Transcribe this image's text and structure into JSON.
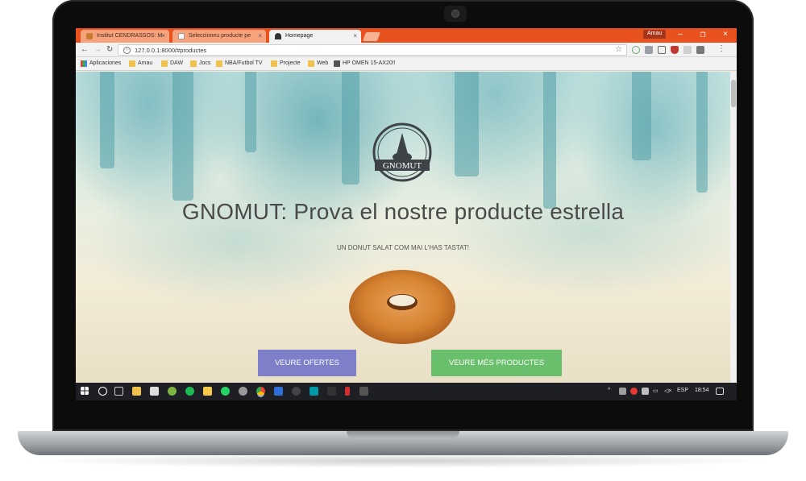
{
  "browser": {
    "tabs": [
      {
        "title": "Institut CENDRASSOS: M"
      },
      {
        "title": "Seleccioneu producte pe"
      },
      {
        "title": "Homepage"
      }
    ],
    "profile_name": "Amau",
    "url": "127.0.0.1:8000/#productes",
    "bookmarks": [
      "Aplicaciones",
      "Amau",
      "DAW",
      "Jocs",
      "NBA/Futbol TV",
      "Projecte",
      "Web",
      "HP OMEN 15-AX20!!"
    ]
  },
  "page": {
    "logo_text": "GNOMUT",
    "headline": "GNOMUT: Prova el nostre producte estrella",
    "tagline": "UN DONUT SALAT COM MAI L'HAS TASTAT!",
    "buttons": {
      "offers": "VEURE OFERTES",
      "products": "VEURE MÉS PRODUCTES"
    }
  },
  "taskbar": {
    "language": "ESP",
    "time": "18:54"
  },
  "colors": {
    "tab_bar": "#e8521f",
    "offers_button": "#7d7fc9",
    "products_button": "#69bf6b"
  }
}
